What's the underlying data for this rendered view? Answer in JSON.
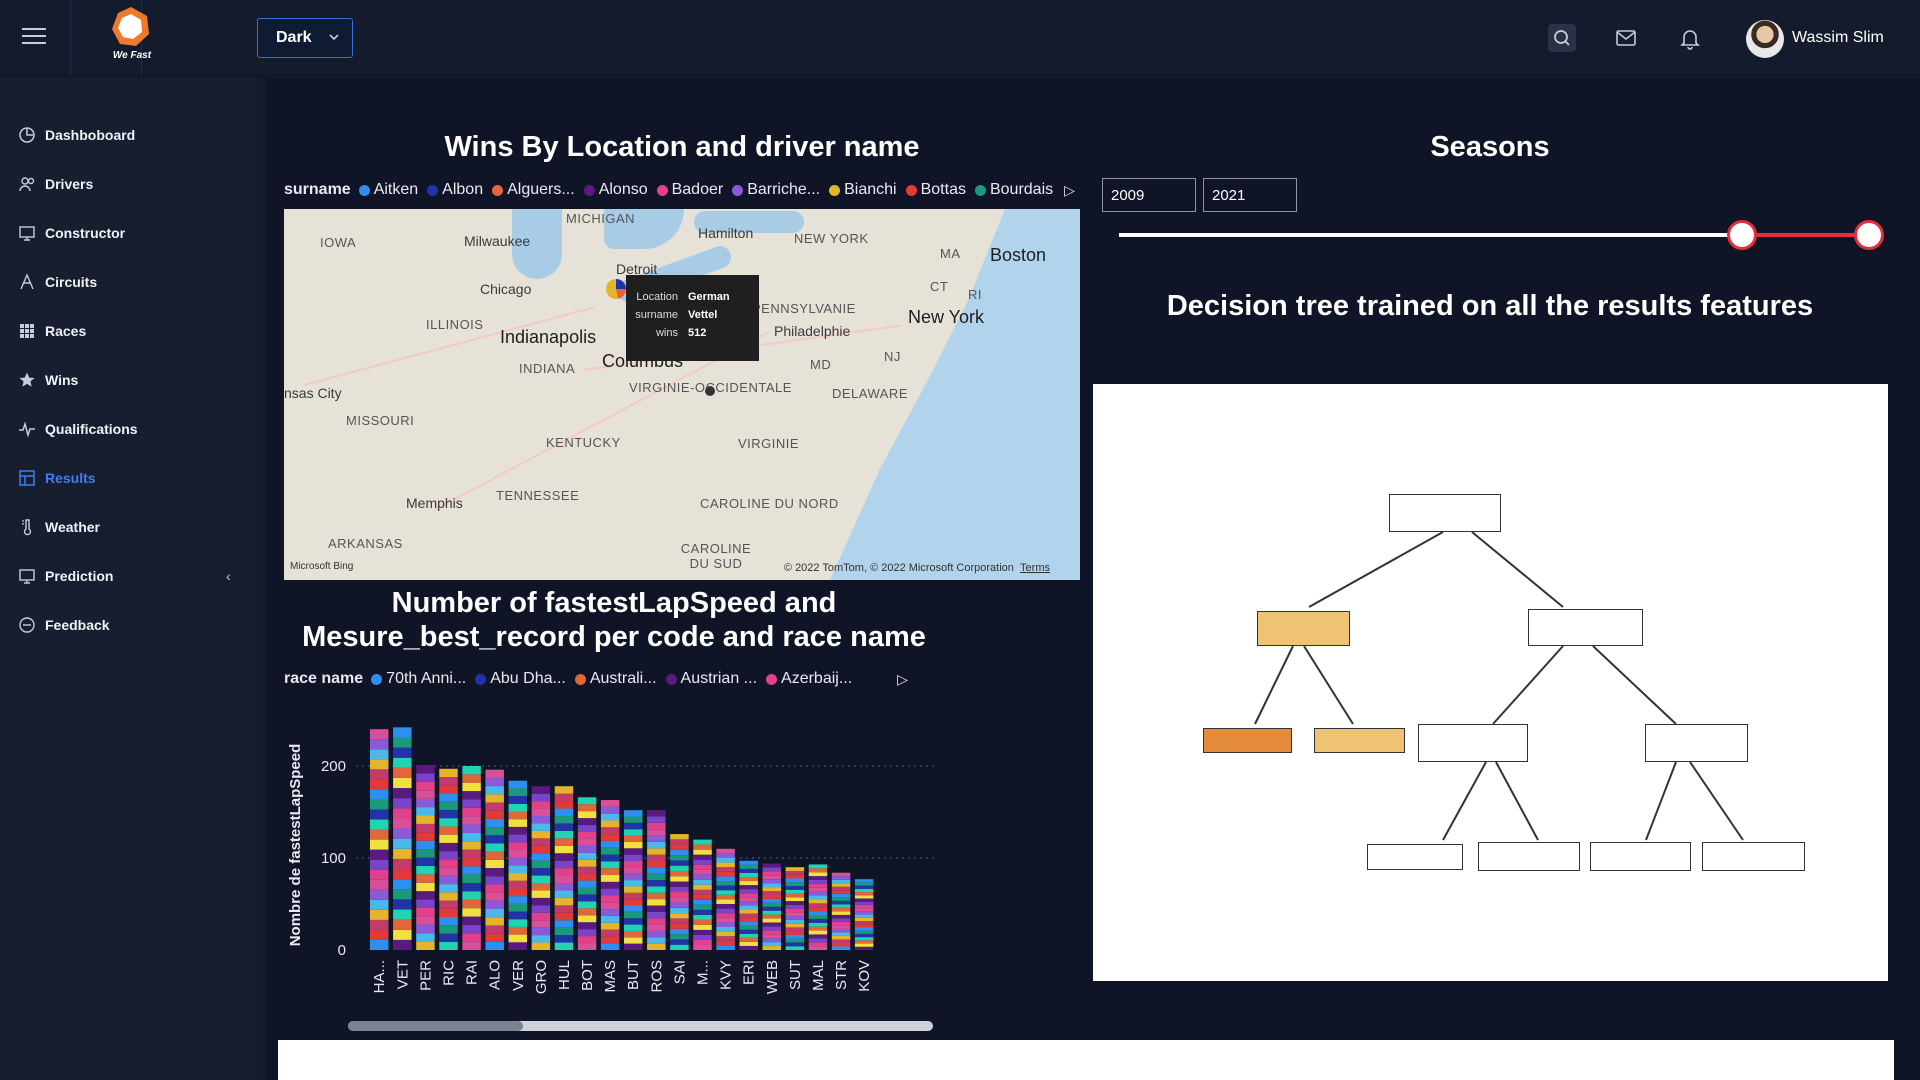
{
  "header": {
    "logo_text": "We Fast",
    "theme_value": "Dark",
    "user_name": "Wassim Slim"
  },
  "sidebar": {
    "items": [
      {
        "label": "Dashboboard",
        "icon": "dashboard-icon"
      },
      {
        "label": "Drivers",
        "icon": "users-icon"
      },
      {
        "label": "Constructor",
        "icon": "monitor-icon"
      },
      {
        "label": "Circuits",
        "icon": "circuit-icon"
      },
      {
        "label": "Races",
        "icon": "grid-icon"
      },
      {
        "label": "Wins",
        "icon": "star-icon"
      },
      {
        "label": "Qualifications",
        "icon": "activity-icon"
      },
      {
        "label": "Results",
        "icon": "table-icon",
        "active": true
      },
      {
        "label": "Weather",
        "icon": "thermometer-icon"
      },
      {
        "label": "Prediction",
        "icon": "monitor-icon",
        "has_children": true
      },
      {
        "label": "Feedback",
        "icon": "feedback-icon"
      }
    ]
  },
  "map_panel": {
    "title": "Wins By Location and driver name",
    "legend_title": "surname",
    "legend": [
      {
        "name": "Aitken",
        "color": "#2f8ff0"
      },
      {
        "name": "Albon",
        "color": "#2233a8"
      },
      {
        "name": "Alguers...",
        "color": "#e0673a"
      },
      {
        "name": "Alonso",
        "color": "#5a1a80"
      },
      {
        "name": "Badoer",
        "color": "#e0418a"
      },
      {
        "name": "Barriche...",
        "color": "#8a5ad8"
      },
      {
        "name": "Bianchi",
        "color": "#e4b52b"
      },
      {
        "name": "Bottas",
        "color": "#e23a3a"
      },
      {
        "name": "Bourdais",
        "color": "#1a9a7a"
      }
    ],
    "map_labels": {
      "states": [
        "IOWA",
        "MICHIGAN",
        "ILLINOIS",
        "INDIANA",
        "MISSOURI",
        "KENTUCKY",
        "TENNESSEE",
        "ARKANSAS",
        "VIRGINIE-OCCIDENTALE",
        "VIRGINIE",
        "CAROLINE DU NORD",
        "CAROLINE DU SUD",
        "NEW YORK",
        "PENNSYLVANIE",
        "DELAWARE",
        "MD",
        "NJ",
        "MA",
        "CT",
        "RI"
      ],
      "cities": [
        "Milwaukee",
        "Chicago",
        "Detroit",
        "Hamilton",
        "Indianapolis",
        "Columbus",
        "Philadelphie",
        "New York",
        "Boston",
        "Memphis",
        "nsas City"
      ]
    },
    "tooltip": {
      "rows": [
        {
          "key": "Location",
          "value": "German"
        },
        {
          "key": "surname",
          "value": "Vettel"
        },
        {
          "key": "wins",
          "value": "512"
        }
      ]
    },
    "credit": "© 2022 TomTom, © 2022 Microsoft Corporation",
    "terms": "Terms",
    "bing": "Microsoft Bing"
  },
  "seasons": {
    "title": "Seasons",
    "from": "2009",
    "to": "2021",
    "range_fraction": [
      0.83,
      1.0
    ]
  },
  "tree_panel": {
    "title": "Decision tree trained on all the results features"
  },
  "bar_panel": {
    "title_line1": "Number of fastestLapSpeed and",
    "title_line2": "Mesure_best_record per code and race name",
    "legend_title": "race name",
    "legend": [
      {
        "name": "70th Anni...",
        "color": "#2f8ff0"
      },
      {
        "name": "Abu Dha...",
        "color": "#2233a8"
      },
      {
        "name": "Australi...",
        "color": "#e0673a"
      },
      {
        "name": "Austrian ...",
        "color": "#5a1a80"
      },
      {
        "name": "Azerbaij...",
        "color": "#e0418a"
      }
    ]
  },
  "chart_data": {
    "type": "bar",
    "stacked": true,
    "title": "",
    "xlabel": "",
    "ylabel": "Nombre de fastestLapSpeed",
    "ylim": [
      0,
      250
    ],
    "yticks": [
      0,
      100,
      200
    ],
    "categories": [
      "HA...",
      "VET",
      "PER",
      "RIC",
      "RAI",
      "ALO",
      "VER",
      "GRO",
      "HUL",
      "BOT",
      "MAS",
      "BUT",
      "ROS",
      "SAI",
      "M...",
      "KVY",
      "ERI",
      "WEB",
      "SUT",
      "MAL",
      "STR",
      "KOV"
    ],
    "values": [
      240,
      242,
      201,
      197,
      200,
      196,
      184,
      178,
      178,
      166,
      163,
      152,
      152,
      126,
      120,
      110,
      97,
      94,
      90,
      93,
      84,
      77
    ],
    "series_colors": [
      "#2f8ff0",
      "#2233a8",
      "#e0673a",
      "#5a1a80",
      "#e0418a",
      "#8a5ad8",
      "#e4b52b",
      "#e23a3a",
      "#1a9a7a",
      "#1fd3b3",
      "#f0e040",
      "#7a44c8",
      "#d84f9a",
      "#4ab8e8",
      "#c23b6a"
    ]
  }
}
